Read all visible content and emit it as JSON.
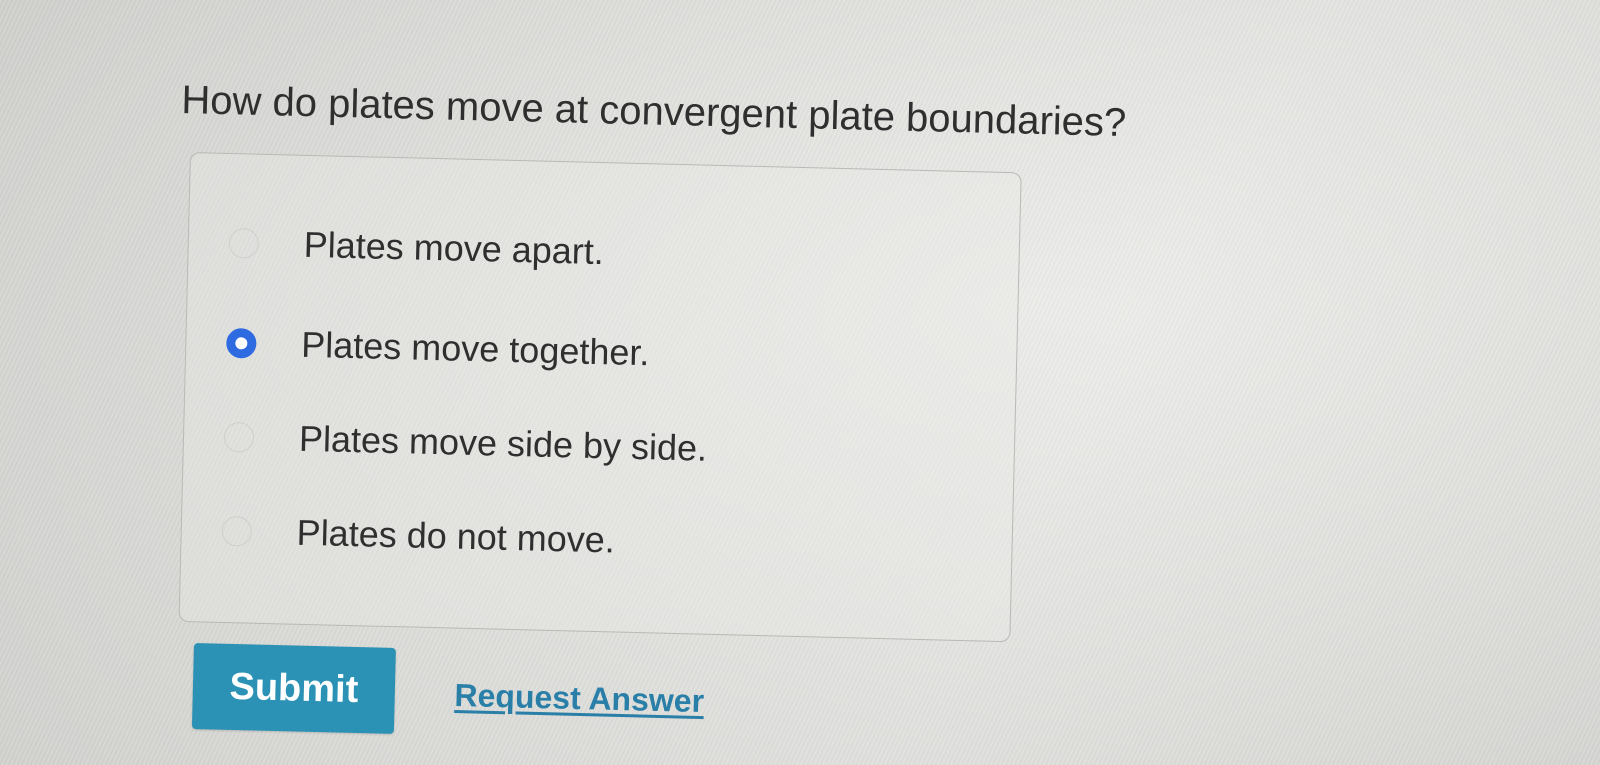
{
  "question": {
    "text": "How do plates move at convergent plate boundaries?"
  },
  "options": [
    {
      "label": "Plates move apart.",
      "selected": false
    },
    {
      "label": "Plates move together.",
      "selected": true
    },
    {
      "label": "Plates move side by side.",
      "selected": false
    },
    {
      "label": "Plates do not move.",
      "selected": false
    }
  ],
  "actions": {
    "submit_label": "Submit",
    "request_answer_label": "Request Answer"
  },
  "colors": {
    "accent_button": "#2b92b5",
    "link": "#2a7fa8",
    "radio_selected": "#2e6ae0"
  }
}
